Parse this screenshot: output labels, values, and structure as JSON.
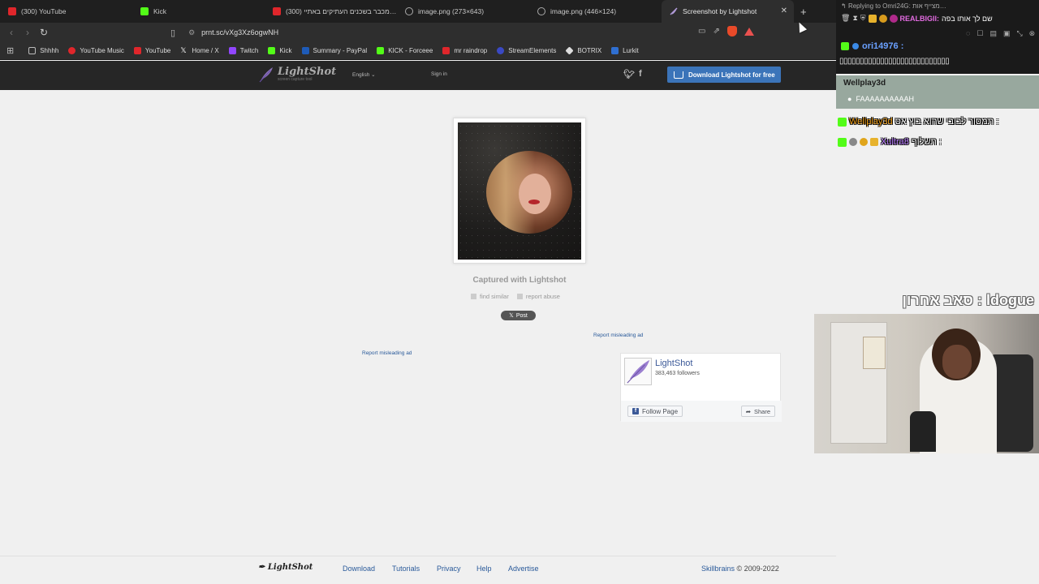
{
  "tabs": [
    {
      "title": "(300) YouTube",
      "icon": "youtube-icon",
      "active": false
    },
    {
      "title": "Kick",
      "icon": "kick-icon",
      "active": false
    },
    {
      "title": "(300) מכבר בשכנים העתיקים באתיי…",
      "icon": "youtube-icon",
      "active": false
    },
    {
      "title": "image.png (273×643)",
      "icon": "globe-icon",
      "active": false
    },
    {
      "title": "image.png (446×124)",
      "icon": "globe-icon",
      "active": false
    },
    {
      "title": "Screenshot by Lightshot",
      "icon": "lightshot-icon",
      "active": true
    }
  ],
  "address": {
    "url": "prnt.sc/vXg3Xz6ogwNH"
  },
  "bookmarks": [
    {
      "label": "Shhhh",
      "icon": "folder-icon"
    },
    {
      "label": "YouTube Music",
      "icon": "youtube-music-icon"
    },
    {
      "label": "YouTube",
      "icon": "youtube-icon"
    },
    {
      "label": "Home / X",
      "icon": "x-icon"
    },
    {
      "label": "Twitch",
      "icon": "twitch-icon"
    },
    {
      "label": "Kick",
      "icon": "kick-icon"
    },
    {
      "label": "Summary - PayPal",
      "icon": "paypal-icon"
    },
    {
      "label": "KICK - Forceee",
      "icon": "kick-icon"
    },
    {
      "label": "mr raindrop",
      "icon": "youtube-icon"
    },
    {
      "label": "StreamElements",
      "icon": "streamelements-icon"
    },
    {
      "label": "BOTRIX",
      "icon": "botrix-icon"
    },
    {
      "label": "Lurkit",
      "icon": "lurkit-icon"
    }
  ],
  "lightshot": {
    "logo": "LightShot",
    "logo_sub": "screen capture tool",
    "language": "English",
    "signin": "Sign in",
    "download_btn": "Download Lightshot for free",
    "captured": "Captured with Lightshot",
    "find_similar": "find similar",
    "report_abuse": "report abuse",
    "x_post": "Post",
    "report_ad_1": "Report misleading ad",
    "report_ad_2": "Report misleading ad",
    "fb": {
      "name": "LightShot",
      "followers": "383,463 followers",
      "follow": "Follow Page",
      "share": "Share"
    },
    "footer": {
      "logo": "LightShot",
      "links": [
        "Download",
        "Tutorials",
        "Privacy",
        "Help",
        "Advertise"
      ],
      "company": "Skillbrains",
      "copyright": "© 2009-2022"
    }
  },
  "chat": {
    "reply_to": "Replying to Omri24G: מצייף אות…",
    "line1_user": "REALBIGII:",
    "line1_text": "שם לך אותו בפה",
    "user2": "ori14976 :",
    "boxes": "▯▯▯▯▯▯▯▯▯▯▯▯▯▯▯▯▯▯▯▯▯▯▯▯▯▯▯",
    "highlight_name": "Wellplay3d",
    "highlight_msg": "FAAAAAAAAAAH",
    "msg3_user": "Wellplay3d",
    "msg3_text": ": תמסור לבובי שהוא בוץ אס",
    "msg4_user": "Xultra8",
    "msg4_text": ": תשלוף",
    "cam_title": "ldogue : סאב אחרון"
  }
}
